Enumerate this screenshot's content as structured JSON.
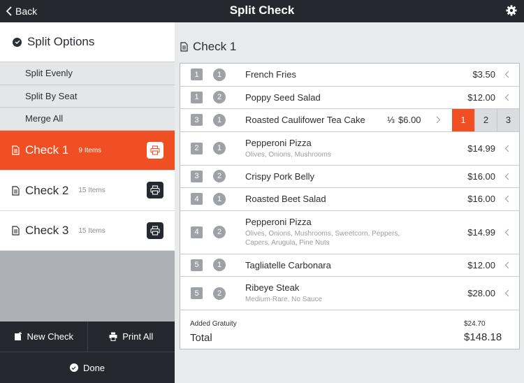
{
  "topbar": {
    "back_label": "Back",
    "title": "Split Check"
  },
  "sidebar": {
    "options_title": "Split Options",
    "options": [
      {
        "label": "Split Evenly"
      },
      {
        "label": "Split By Seat"
      },
      {
        "label": "Merge All"
      }
    ],
    "checks": [
      {
        "name": "Check 1",
        "count": "9 Items",
        "active": true
      },
      {
        "name": "Check 2",
        "count": "15 Items",
        "active": false
      },
      {
        "name": "Check 3",
        "count": "15 Items",
        "active": false
      }
    ],
    "new_check_label": "New Check",
    "print_all_label": "Print All",
    "done_label": "Done"
  },
  "main": {
    "title": "Check 1",
    "items": [
      {
        "seat": "1",
        "guest": "1",
        "name": "French Fries",
        "mods": "",
        "price": "$3.50"
      },
      {
        "seat": "1",
        "guest": "2",
        "name": "Poppy Seed Salad",
        "mods": "",
        "price": "$12.00"
      },
      {
        "seat": "3",
        "guest": "1",
        "name": "Roasted Caulifower Tea Cake",
        "mods": "",
        "split_fraction": "⅓",
        "price": "$6.00",
        "split_options": [
          "1",
          "2",
          "3"
        ],
        "split_selected": "1"
      },
      {
        "seat": "2",
        "guest": "1",
        "name": "Pepperoni Pizza",
        "mods": "Olives, Onions, Mushrooms",
        "price": "$14.99"
      },
      {
        "seat": "3",
        "guest": "2",
        "name": "Crispy Pork Belly",
        "mods": "",
        "price": "$16.00"
      },
      {
        "seat": "4",
        "guest": "1",
        "name": "Roasted Beet Salad",
        "mods": "",
        "price": "$16.00"
      },
      {
        "seat": "4",
        "guest": "2",
        "name": "Pepperoni Pizza",
        "mods_line1": "Olives, Onions, Mushrooms, Sweetcorn, Peppers,",
        "mods_line2": "Capers, Arugula, Pine Nuts",
        "price": "$14.99"
      },
      {
        "seat": "5",
        "guest": "1",
        "name": "Tagliatelle Carbonara",
        "mods": "",
        "price": "$12.00"
      },
      {
        "seat": "5",
        "guest": "2",
        "name": "Ribeye Steak",
        "mods": "Medium-Rare, No Sauce",
        "price": "$28.00"
      }
    ],
    "gratuity_label": "Added Gratuity",
    "gratuity_value": "$24.70",
    "total_label": "Total",
    "total_value": "$148.18"
  },
  "colors": {
    "accent": "#f04e23",
    "dark": "#25292f",
    "sidebar_gray": "#adb0b5",
    "content_bg": "#e9eaec"
  },
  "icons": {
    "back": "chevron-left-icon",
    "settings": "gear-icon",
    "options": "check-circle-icon",
    "check": "document-icon",
    "print": "printer-icon",
    "new_check": "new-document-icon",
    "done": "check-circle-icon",
    "row": "chevron-left-icon"
  }
}
